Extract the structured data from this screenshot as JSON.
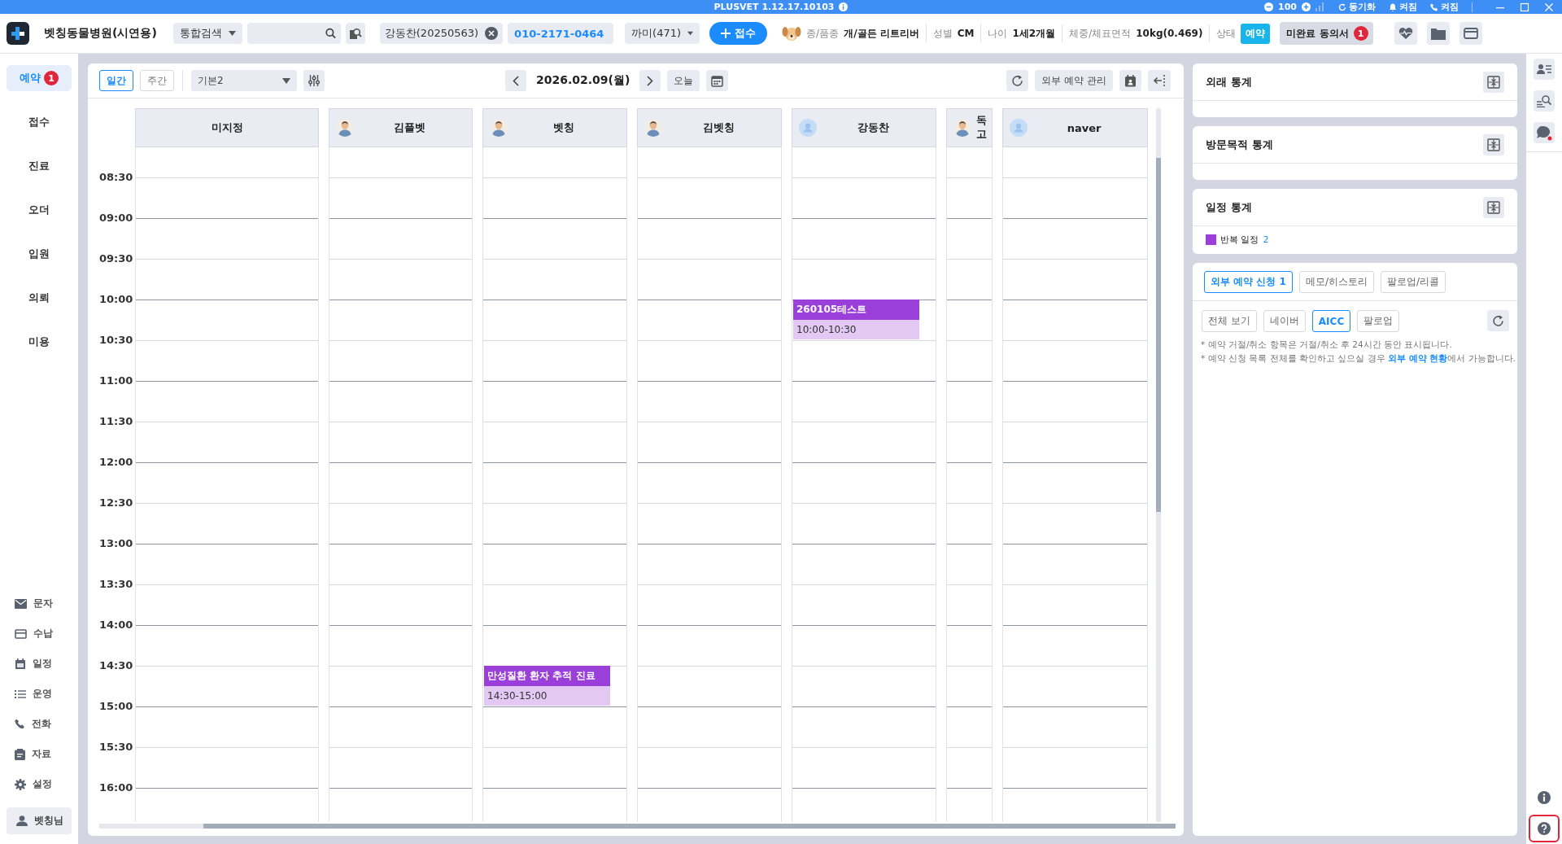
{
  "title_bar": {
    "title": "PLUSVET 1.12.17.10103",
    "zoom": "100",
    "sync": "동기화",
    "notification": "켜짐",
    "phone": "켜짐"
  },
  "header": {
    "clinic": "벳칭동물병원(시연용)",
    "search_type": "통합검색",
    "patient": "강동찬(20250563)",
    "phone": "010-2171-0464",
    "pet": "까미(471)",
    "register_button": "접수",
    "info": [
      {
        "label": "종/품종",
        "value": "개/골든 리트리버",
        "kind": "text"
      },
      {
        "label": "성별",
        "value": "CM",
        "kind": "text"
      },
      {
        "label": "나이",
        "value": "1세2개월",
        "kind": "text"
      },
      {
        "label": "체중/체표면적",
        "value": "10kg(0.469)",
        "kind": "text"
      },
      {
        "label": "상태",
        "value": "예약",
        "kind": "badge"
      }
    ],
    "consent": {
      "label": "미완료 동의서",
      "count": "1"
    }
  },
  "sidebar": {
    "items": [
      {
        "label": "예약",
        "selected": true,
        "badge": "1"
      },
      {
        "label": "접수",
        "selected": false
      },
      {
        "label": "진료",
        "selected": false
      },
      {
        "label": "오더",
        "selected": false
      },
      {
        "label": "입원",
        "selected": false
      },
      {
        "label": "의뢰",
        "selected": false
      },
      {
        "label": "미용",
        "selected": false
      }
    ],
    "tools": [
      {
        "label": "문자",
        "kind": "mail"
      },
      {
        "label": "수납",
        "kind": "card"
      },
      {
        "label": "일정",
        "kind": "calendar"
      },
      {
        "label": "운영",
        "kind": "list"
      },
      {
        "label": "전화",
        "kind": "phone"
      },
      {
        "label": "자료",
        "kind": "clipboard"
      },
      {
        "label": "설정",
        "kind": "gear"
      }
    ],
    "user": "벳칭님"
  },
  "calendar": {
    "views": [
      {
        "label": "일간",
        "selected": true
      },
      {
        "label": "주간",
        "selected": false
      }
    ],
    "preset": "기본2",
    "date": "2026.02.09(월)",
    "today": "오늘",
    "external_button": "외부 예약 관리",
    "times": [
      "08:30",
      "09:00",
      "09:30",
      "10:00",
      "10:30",
      "11:00",
      "11:30",
      "12:00",
      "12:30",
      "13:00",
      "13:30",
      "14:00",
      "14:30",
      "15:00",
      "15:30",
      "16:00"
    ],
    "columns": [
      {
        "name": "미지정",
        "kind": "plain"
      },
      {
        "name": "김플벳",
        "kind": "figure"
      },
      {
        "name": "벳칭",
        "kind": "figure",
        "events": [
          {
            "title": "만성질환 환자 추적 진료",
            "time": "14:30-15:00"
          }
        ]
      },
      {
        "name": "김벳칭",
        "kind": "figure"
      },
      {
        "name": "강동찬",
        "kind": "default",
        "events": [
          {
            "title": "260105테스트",
            "time": "10:00-10:30"
          }
        ]
      },
      {
        "name": "독고",
        "kind": "figure"
      },
      {
        "name": "naver",
        "kind": "default"
      }
    ]
  },
  "stats": [
    {
      "title": "외래 통계"
    },
    {
      "title": "방문목적 통계"
    },
    {
      "title": "일정 통계",
      "legend": [
        {
          "label": "반복 일정",
          "count": "2",
          "color": "#9b3fdb"
        }
      ]
    }
  ],
  "requests": {
    "tabs": [
      {
        "label": "외부 예약 신청 1",
        "selected": true
      },
      {
        "label": "메모/히스토리",
        "selected": false
      },
      {
        "label": "팔로업/리콜",
        "selected": false
      }
    ],
    "filters": [
      {
        "label": "전체 보기",
        "selected": false
      },
      {
        "label": "네이버",
        "selected": false
      },
      {
        "label": "AICC",
        "selected": true
      },
      {
        "label": "팔로업",
        "selected": false
      }
    ],
    "notes": [
      {
        "text": "* 예약 거절/취소 항목은 거절/취소 후 24시간 동안 표시됩니다."
      },
      {
        "text": "* 예약 신청 목록 전체를 확인하고 싶으실 경우 ",
        "link": "외부 예약 현황",
        "after": "에서 가능합니다."
      }
    ]
  }
}
